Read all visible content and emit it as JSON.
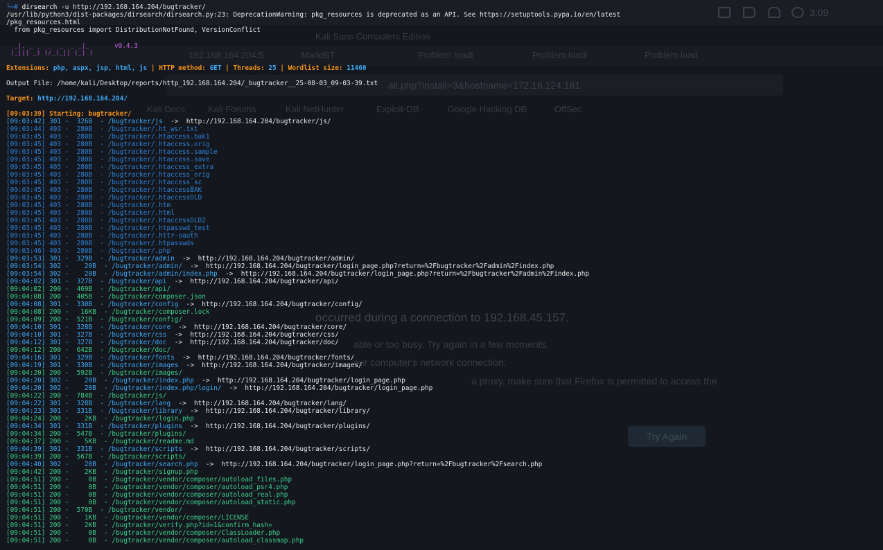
{
  "background": {
    "clock": "3:09",
    "window_title": "Kali Sans Computers Edition",
    "tabs": [
      "192.168.164.204:5",
      "MarkiBT",
      "Problem loadi",
      "Problem loadi",
      "Problem load"
    ],
    "url": "all.php?install=3&hostname=172.16.124.181",
    "bookmarks": [
      "Kali Docs",
      "Kali Forums",
      "Kali NetHunter",
      "Exploit-DB",
      "Google Hacking DB",
      "OffSec"
    ],
    "error_heading": "occurred during a connection to 192.168.45.157.",
    "error_lines": [
      "able or too busy. Try again in a few moments.",
      "our computer's network connection.",
      "a proxy, make sure that Firefox is permitted to access the"
    ],
    "try_again_label": "Try Again"
  },
  "terminal": {
    "prompt_symbol": "└─#",
    "command": "dirsearch",
    "command_args": "-u http://192.168.164.204/bugtracker/",
    "warning_lines": [
      "/usr/lib/python3/dist-packages/dirsearch/dirsearch.py:23: DeprecationWarning: pkg_resources is deprecated as an API. See https://setuptools.pypa.io/en/latest",
      "/pkg_resources.html",
      "  from pkg_resources import DistributionNotFound, VersionConflict"
    ],
    "banner_art": " _|. _ _  _  _  _ _|_\n(_||| _) (/_(_|| (_| )",
    "version": "v0.4.3",
    "config": {
      "extensions_label": "Extensions:",
      "extensions": "php, aspx, jsp, html, js",
      "method_label": "HTTP method:",
      "method": "GET",
      "threads_label": "Threads:",
      "threads": "25",
      "wordlist_label": "Wordlist size:",
      "wordlist_size": "11460"
    },
    "output_file": "Output File: /home/kali/Desktop/reports/http_192.168.164.204/_bugtracker__25-08-03_09-03-39.txt",
    "target_label": "Target:",
    "target": "http://192.168.164.204/",
    "starting_time": "[09:03:39]",
    "starting_text": "Starting: bugtracker/",
    "results": [
      {
        "time": "[09:03:42]",
        "code": "301",
        "size": " 326B",
        "path": "/bugtracker/js",
        "redirect": "http://192.168.164.204/bugtracker/js/"
      },
      {
        "time": "[09:03:44]",
        "code": "403",
        "size": " 280B",
        "path": "/bugtracker/.ht_wsr.txt",
        "redirect": ""
      },
      {
        "time": "[09:03:45]",
        "code": "403",
        "size": " 280B",
        "path": "/bugtracker/.htaccess.bak1",
        "redirect": ""
      },
      {
        "time": "[09:03:45]",
        "code": "403",
        "size": " 280B",
        "path": "/bugtracker/.htaccess.orig",
        "redirect": ""
      },
      {
        "time": "[09:03:45]",
        "code": "403",
        "size": " 280B",
        "path": "/bugtracker/.htaccess.sample",
        "redirect": ""
      },
      {
        "time": "[09:03:45]",
        "code": "403",
        "size": " 280B",
        "path": "/bugtracker/.htaccess.save",
        "redirect": ""
      },
      {
        "time": "[09:03:45]",
        "code": "403",
        "size": " 280B",
        "path": "/bugtracker/.htaccess_extra",
        "redirect": ""
      },
      {
        "time": "[09:03:45]",
        "code": "403",
        "size": " 280B",
        "path": "/bugtracker/.htaccess_orig",
        "redirect": ""
      },
      {
        "time": "[09:03:45]",
        "code": "403",
        "size": " 280B",
        "path": "/bugtracker/.htaccess_sc",
        "redirect": ""
      },
      {
        "time": "[09:03:45]",
        "code": "403",
        "size": " 280B",
        "path": "/bugtracker/.htaccessBAK",
        "redirect": ""
      },
      {
        "time": "[09:03:45]",
        "code": "403",
        "size": " 280B",
        "path": "/bugtracker/.htaccessOLD",
        "redirect": ""
      },
      {
        "time": "[09:03:45]",
        "code": "403",
        "size": " 280B",
        "path": "/bugtracker/.htm",
        "redirect": ""
      },
      {
        "time": "[09:03:45]",
        "code": "403",
        "size": " 280B",
        "path": "/bugtracker/.html",
        "redirect": ""
      },
      {
        "time": "[09:03:45]",
        "code": "403",
        "size": " 280B",
        "path": "/bugtracker/.htaccessOLD2",
        "redirect": ""
      },
      {
        "time": "[09:03:45]",
        "code": "403",
        "size": " 280B",
        "path": "/bugtracker/.htpasswd_test",
        "redirect": ""
      },
      {
        "time": "[09:03:45]",
        "code": "403",
        "size": " 280B",
        "path": "/bugtracker/.httr-oauth",
        "redirect": ""
      },
      {
        "time": "[09:03:45]",
        "code": "403",
        "size": " 280B",
        "path": "/bugtracker/.htpasswds",
        "redirect": ""
      },
      {
        "time": "[09:03:46]",
        "code": "403",
        "size": " 280B",
        "path": "/bugtracker/.php",
        "redirect": ""
      },
      {
        "time": "[09:03:53]",
        "code": "301",
        "size": " 329B",
        "path": "/bugtracker/admin",
        "redirect": "http://192.168.164.204/bugtracker/admin/"
      },
      {
        "time": "[09:03:54]",
        "code": "302",
        "size": "   20B",
        "path": "/bugtracker/admin/",
        "redirect": "http://192.168.164.204/bugtracker/login_page.php?return=%2Fbugtracker%2Fadmin%2Findex.php"
      },
      {
        "time": "[09:03:54]",
        "code": "302",
        "size": "   20B",
        "path": "/bugtracker/admin/index.php",
        "redirect": "http://192.168.164.204/bugtracker/login_page.php?return=%2Fbugtracker%2Fadmin%2Findex.php"
      },
      {
        "time": "[09:04:02]",
        "code": "301",
        "size": " 327B",
        "path": "/bugtracker/api",
        "redirect": "http://192.168.164.204/bugtracker/api/"
      },
      {
        "time": "[09:04:02]",
        "code": "200",
        "size": " 469B",
        "path": "/bugtracker/api/",
        "redirect": ""
      },
      {
        "time": "[09:04:08]",
        "code": "200",
        "size": " 405B",
        "path": "/bugtracker/composer.json",
        "redirect": ""
      },
      {
        "time": "[09:04:08]",
        "code": "301",
        "size": " 330B",
        "path": "/bugtracker/config",
        "redirect": "http://192.168.164.204/bugtracker/config/"
      },
      {
        "time": "[09:04:08]",
        "code": "200",
        "size": "  16KB",
        "path": "/bugtracker/composer.lock",
        "redirect": ""
      },
      {
        "time": "[09:04:09]",
        "code": "200",
        "size": " 521B",
        "path": "/bugtracker/config/",
        "redirect": ""
      },
      {
        "time": "[09:04:10]",
        "code": "301",
        "size": " 328B",
        "path": "/bugtracker/core",
        "redirect": "http://192.168.164.204/bugtracker/core/"
      },
      {
        "time": "[09:04:10]",
        "code": "301",
        "size": " 327B",
        "path": "/bugtracker/css",
        "redirect": "http://192.168.164.204/bugtracker/css/"
      },
      {
        "time": "[09:04:12]",
        "code": "301",
        "size": " 327B",
        "path": "/bugtracker/doc",
        "redirect": "http://192.168.164.204/bugtracker/doc/"
      },
      {
        "time": "[09:04:12]",
        "code": "200",
        "size": " 642B",
        "path": "/bugtracker/doc/",
        "redirect": ""
      },
      {
        "time": "[09:04:16]",
        "code": "301",
        "size": " 329B",
        "path": "/bugtracker/fonts",
        "redirect": "http://192.168.164.204/bugtracker/fonts/"
      },
      {
        "time": "[09:04:19]",
        "code": "301",
        "size": " 330B",
        "path": "/bugtracker/images",
        "redirect": "http://192.168.164.204/bugtracker/images/"
      },
      {
        "time": "[09:04:20]",
        "code": "200",
        "size": " 592B",
        "path": "/bugtracker/images/",
        "redirect": ""
      },
      {
        "time": "[09:04:20]",
        "code": "302",
        "size": "   20B",
        "path": "/bugtracker/index.php",
        "redirect": "http://192.168.164.204/bugtracker/login_page.php"
      },
      {
        "time": "[09:04:20]",
        "code": "302",
        "size": "   20B",
        "path": "/bugtracker/index.php/login/",
        "redirect": "http://192.168.164.204/bugtracker/login_page.php"
      },
      {
        "time": "[09:04:22]",
        "code": "200",
        "size": " 784B",
        "path": "/bugtracker/js/",
        "redirect": ""
      },
      {
        "time": "[09:04:22]",
        "code": "301",
        "size": " 328B",
        "path": "/bugtracker/lang",
        "redirect": "http://192.168.164.204/bugtracker/lang/"
      },
      {
        "time": "[09:04:23]",
        "code": "301",
        "size": " 331B",
        "path": "/bugtracker/library",
        "redirect": "http://192.168.164.204/bugtracker/library/"
      },
      {
        "time": "[09:04:24]",
        "code": "200",
        "size": "   2KB",
        "path": "/bugtracker/login.php",
        "redirect": ""
      },
      {
        "time": "[09:04:34]",
        "code": "301",
        "size": " 331B",
        "path": "/bugtracker/plugins",
        "redirect": "http://192.168.164.204/bugtracker/plugins/"
      },
      {
        "time": "[09:04:34]",
        "code": "200",
        "size": " 547B",
        "path": "/bugtracker/plugins/",
        "redirect": ""
      },
      {
        "time": "[09:04:37]",
        "code": "200",
        "size": "   5KB",
        "path": "/bugtracker/readme.md",
        "redirect": ""
      },
      {
        "time": "[09:04:39]",
        "code": "301",
        "size": " 331B",
        "path": "/bugtracker/scripts",
        "redirect": "http://192.168.164.204/bugtracker/scripts/"
      },
      {
        "time": "[09:04:39]",
        "code": "200",
        "size": " 567B",
        "path": "/bugtracker/scripts/",
        "redirect": ""
      },
      {
        "time": "[09:04:40]",
        "code": "302",
        "size": "   20B",
        "path": "/bugtracker/search.php",
        "redirect": "http://192.168.164.204/bugtracker/login_page.php?return=%2Fbugtracker%2Fsearch.php"
      },
      {
        "time": "[09:04:42]",
        "code": "200",
        "size": "   2KB",
        "path": "/bugtracker/signup.php",
        "redirect": ""
      },
      {
        "time": "[09:04:51]",
        "code": "200",
        "size": "    0B",
        "path": "/bugtracker/vendor/composer/autoload_files.php",
        "redirect": ""
      },
      {
        "time": "[09:04:51]",
        "code": "200",
        "size": "    0B",
        "path": "/bugtracker/vendor/composer/autoload_psr4.php",
        "redirect": ""
      },
      {
        "time": "[09:04:51]",
        "code": "200",
        "size": "    0B",
        "path": "/bugtracker/vendor/composer/autoload_real.php",
        "redirect": ""
      },
      {
        "time": "[09:04:51]",
        "code": "200",
        "size": "    0B",
        "path": "/bugtracker/vendor/composer/autoload_static.php",
        "redirect": ""
      },
      {
        "time": "[09:04:51]",
        "code": "200",
        "size": " 570B",
        "path": "/bugtracker/vendor/",
        "redirect": ""
      },
      {
        "time": "[09:04:51]",
        "code": "200",
        "size": "   1KB",
        "path": "/bugtracker/vendor/composer/LICENSE",
        "redirect": ""
      },
      {
        "time": "[09:04:51]",
        "code": "200",
        "size": "   2KB",
        "path": "/bugtracker/verify.php?id=1&confirm_hash=",
        "redirect": ""
      },
      {
        "time": "[09:04:51]",
        "code": "200",
        "size": "    0B",
        "path": "/bugtracker/vendor/composer/ClassLoader.php",
        "redirect": ""
      },
      {
        "time": "[09:04:51]",
        "code": "200",
        "size": "    0B",
        "path": "/bugtracker/vendor/composer/autoload_classmap.php",
        "redirect": ""
      }
    ]
  }
}
